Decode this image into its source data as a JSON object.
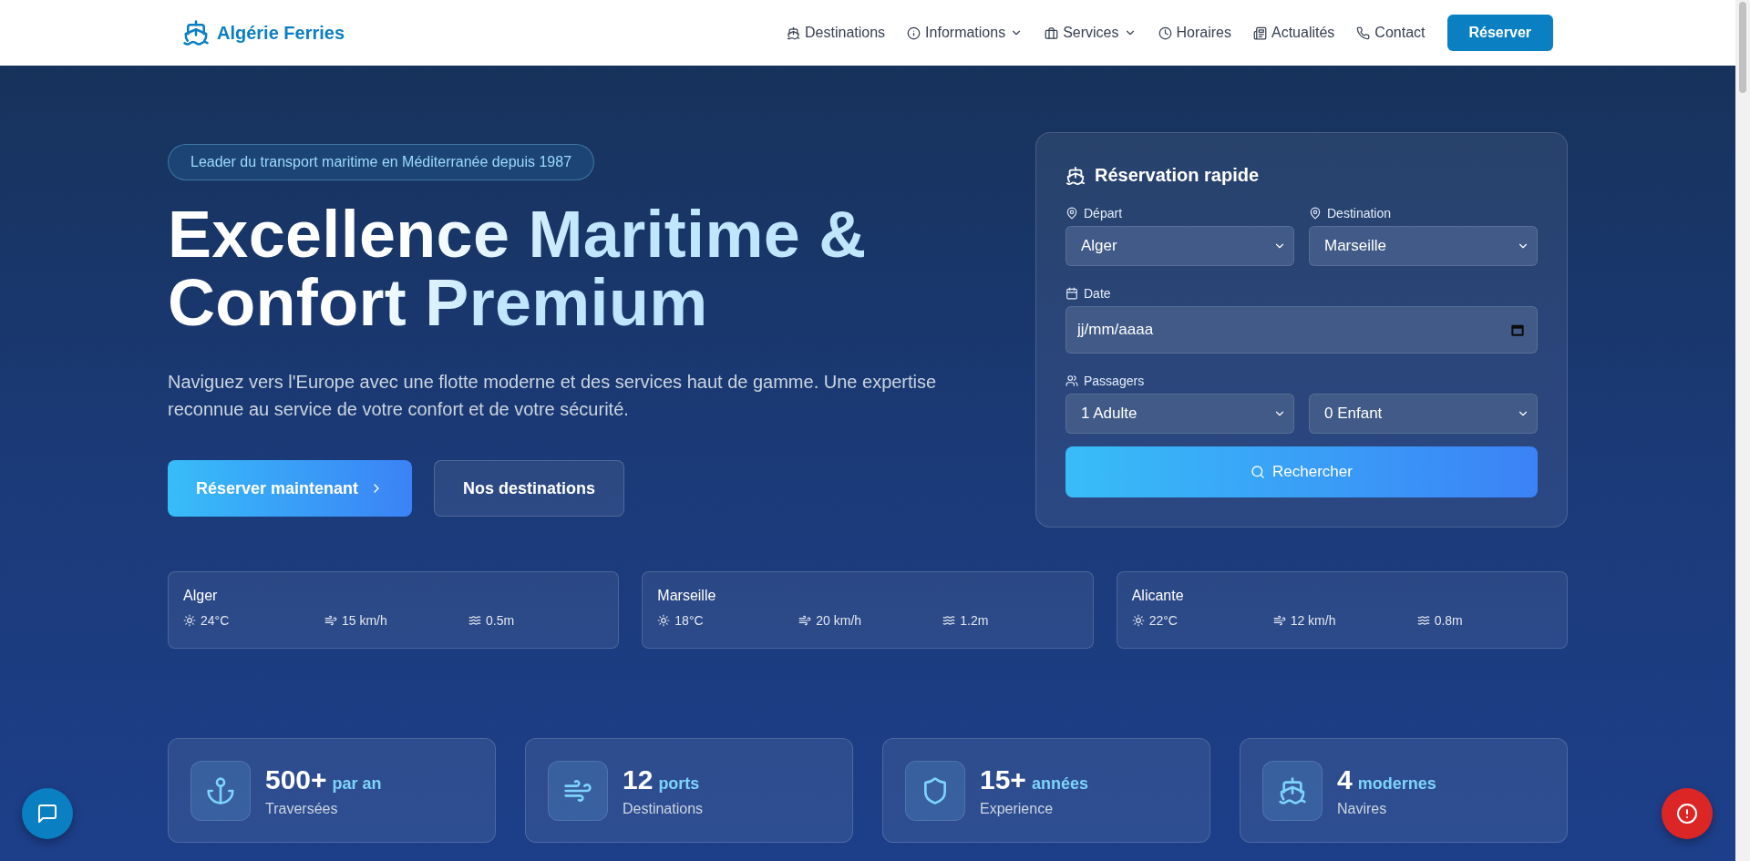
{
  "header": {
    "brand": "Algérie Ferries",
    "nav": [
      {
        "label": "Destinations",
        "dropdown": false
      },
      {
        "label": "Informations",
        "dropdown": true
      },
      {
        "label": "Services",
        "dropdown": true
      },
      {
        "label": "Horaires",
        "dropdown": false
      },
      {
        "label": "Actualités",
        "dropdown": false
      },
      {
        "label": "Contact",
        "dropdown": false
      }
    ],
    "cta": "Réserver"
  },
  "hero": {
    "badge": "Leader du transport maritime en Méditerranée depuis 1987",
    "title_lines": [
      "Excellence Maritime &",
      "Confort Premium"
    ],
    "description": "Naviguez vers l'Europe avec une flotte moderne et des services haut de gamme. Une expertise reconnue au service de votre confort et de votre sécurité.",
    "buttons": [
      {
        "label": "Réserver maintenant",
        "kind": "primary"
      },
      {
        "label": "Nos destinations",
        "kind": "secondary"
      }
    ]
  },
  "booking": {
    "title": "Réservation rapide",
    "departure": {
      "label": "Départ",
      "value": "Alger"
    },
    "destination": {
      "label": "Destination",
      "value": "Marseille"
    },
    "date": {
      "label": "Date",
      "placeholder": "jj/mm/aaaa"
    },
    "passengers": {
      "label": "Passagers",
      "adults": "1 Adulte",
      "children": "0 Enfant"
    },
    "submit": "Rechercher"
  },
  "weather": [
    {
      "city": "Alger",
      "temperature": "24°C",
      "wind": "15 km/h",
      "waves": "0.5m"
    },
    {
      "city": "Marseille",
      "temperature": "18°C",
      "wind": "20 km/h",
      "waves": "1.2m"
    },
    {
      "city": "Alicante",
      "temperature": "22°C",
      "wind": "12 km/h",
      "waves": "0.8m"
    }
  ],
  "stats": [
    {
      "value": "500+",
      "unit": "par an",
      "label": "Traversées"
    },
    {
      "value": "12",
      "unit": "ports",
      "label": "Destinations"
    },
    {
      "value": "15+",
      "unit": "années",
      "label": "Experience"
    },
    {
      "value": "4",
      "unit": "modernes",
      "label": "Navires"
    }
  ]
}
